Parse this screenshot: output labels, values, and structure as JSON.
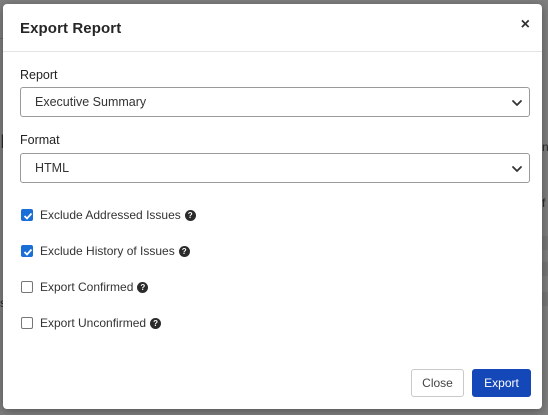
{
  "background": {
    "heading_fragment": "n",
    "right_fragment_1": "n",
    "right_fragment_2": "f",
    "left_fragment": "s"
  },
  "dialog": {
    "title": "Export Report",
    "close_icon": "×",
    "report_label": "Report",
    "report_value": "Executive Summary",
    "format_label": "Format",
    "format_value": "HTML",
    "options": [
      {
        "label": "Exclude Addressed Issues",
        "checked": true
      },
      {
        "label": "Exclude History of Issues",
        "checked": true
      },
      {
        "label": "Export Confirmed",
        "checked": false
      },
      {
        "label": "Export Unconfirmed",
        "checked": false
      }
    ],
    "help_glyph": "?",
    "close_button": "Close",
    "export_button": "Export"
  },
  "colors": {
    "primary": "#1447b8",
    "checkbox": "#1a6fd6",
    "overlay": "#7f7f7f"
  },
  "icons": [
    "close-icon",
    "chevron-down-icon",
    "question-circle-icon",
    "checkmark-icon"
  ]
}
